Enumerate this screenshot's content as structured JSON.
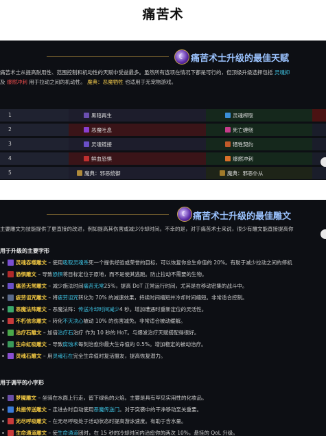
{
  "page_title": "痛苦术",
  "talents_section": {
    "heading": "痛苦术士升级的最佳天赋",
    "intro_line1": "痛苦术士从提高耐用性、范围控制和机动性的天赋中受益最多。虽然所有选项在情况下都是可行的，但顶级升级选择包括",
    "intro_line1_hl": "灵魂抑",
    "intro_line2_a": "及",
    "intro_line2_hl1": "爆燃冲刺",
    "intro_line2_b": "用于拉动之间的机动性。",
    "intro_line2_hl2": "魔典：恶魔牺牲",
    "intro_line2_c": "也适用于无宠物游戏。",
    "rows": [
      {
        "num": "1",
        "left": "黑暗再生",
        "right": "灵魂榨取",
        "left_color": "#6b4fb0",
        "right_color": "#3a8fd8"
      },
      {
        "num": "2",
        "left": "恶魔吐息",
        "right": "死亡缠绕",
        "left_color": "#8a3fd0",
        "right_color": "#c63c8a"
      },
      {
        "num": "3",
        "left": "灵魂链接",
        "right": "牺牲契约",
        "left_color": "#6a4fc8",
        "right_color": "#c05a2a"
      },
      {
        "num": "4",
        "left": "鲜血恐惧",
        "right": "爆燃冲刺",
        "left_color": "#c03030",
        "right_color": "#d8702a"
      },
      {
        "num": "5",
        "left": "魔典：邪恶统御",
        "right": "魔典：邪恶仆从",
        "left_color": "#b08a3a",
        "right_color": "#a07a2a"
      }
    ]
  },
  "glyphs_section": {
    "heading": "痛苦术士升级的最佳雕文",
    "intro": "主要雕文为技能提供了更直接的改进，例如提高其伤害或减少冷却时间。不幸的是，对于痛苦术士来说，很少有雕文能直接提高你",
    "major_title": "用于升级的主要字形",
    "major": [
      {
        "name": "灵魂吞噬雕文",
        "text": "– 使用",
        "hl": "吸取灵魂杀",
        "rest": "死一个提供经验或荣誉的目标，可以恢复你总生命值的 20%。有助于减少拉动之间的停机",
        "icon": "#7a4fd0"
      },
      {
        "name": "恐惧雕文",
        "text": "– 导致",
        "hl": "恐惧",
        "rest": "将目标定位于原地，而不是使其逃跑。防止拉动不需要的生物。",
        "icon": "#b02a2a"
      },
      {
        "name": "痛苦无常雕文",
        "text": "– 减少施法时间",
        "hl": "痛苦无常",
        "rest": "25%，提高 DoT 正常运行时间，尤其是在移动密集的战斗中。",
        "icon": "#6a4fc8"
      },
      {
        "name": "疲劳诅咒雕文",
        "text": "– 将",
        "hl": "疲劳诅咒",
        "rest": "转化为 70% 的减速效果，持续时间缩短并冷却时间缩短。非常适合控制。",
        "icon": "#5a6a8a"
      },
      {
        "name": "恶魔法阵雕文",
        "text": "– 恶魔法阵：",
        "hl": "传送冷却时间减少",
        "rest": "4 秒。增加遭遇时重新定位的灵活性。",
        "icon": "#3aa86a"
      },
      {
        "name": "不朽信念雕文",
        "text": "– 转化",
        "hl": "不灭决心",
        "rest": "被动 10% 的伤害减免。非常适合被动缓解。",
        "icon": "#c83a3a"
      },
      {
        "name": "治疗石雕文",
        "text": "– 加倍",
        "hl": "治疗石",
        "rest": "治疗 作为 10 秒的 HoT。与爆发治疗天赋搭配得很好。",
        "icon": "#4aa84a"
      },
      {
        "name": "生命虹吸雕文",
        "text": "– 导致",
        "hl": "腐蚀术",
        "rest": "每刻治愈你最大生命值的 0.5%。增加稳定的被动治疗。",
        "icon": "#3a9a5a"
      },
      {
        "name": "灵魂石雕文",
        "text": "– 用",
        "hl": "灵魂石在",
        "rest": "完全生命值时复活盟友，提高恢复潜力。",
        "icon": "#8a4fd0"
      }
    ],
    "minor_title": "用于调平的小字形",
    "minor": [
      {
        "name": "梦魇雕文",
        "text": "– 坐骑在水面上行走，留下绿色的火焰。主要是具有罕见实用性的化妆品。",
        "hl": "",
        "rest": "",
        "icon": "#6a4fa8"
      },
      {
        "name": "共振传送雕文",
        "text": "– 走进去时自动使用",
        "hl": "恶魔传送门",
        "rest": "。对于突袭中的干净移动至关重要。",
        "icon": "#3a7ad8"
      },
      {
        "name": "无尽呼吸雕文",
        "text": "– 在无尽呼吸处于活动状态时",
        "hl": "",
        "rest": "提高游泳速度。有助于含水量。",
        "icon": "#c83a3a"
      },
      {
        "name": "生命通道雕文",
        "text": "– 使",
        "hl": "生命通道",
        "rest": "团时，在 15 秒的冷却时间内治愈你的两次 10%，悬挂的 QoL 升级。",
        "icon": "#c83a3a"
      }
    ]
  }
}
